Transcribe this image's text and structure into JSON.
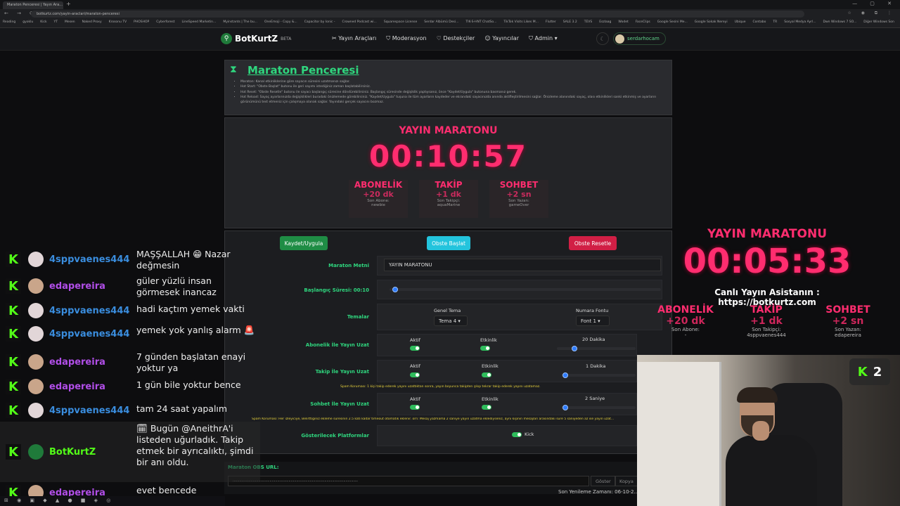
{
  "browser": {
    "tab_title": "Maraton Penceresi | Yayın Ara...",
    "url": "botkurtz.com/yayin-araclari/maraton-penceresi",
    "bookmarks": [
      "Reading",
      "gyoklu",
      "Kick",
      "YT",
      "Mesen",
      "Naked Proxy",
      "Krosonu TV",
      "PHOSHOP",
      "Cyberforest",
      "LineSpeed Marketin...",
      "Myinstants | The bu...",
      "OneEmoji - Copy &...",
      "Capacitor by Ionic -",
      "Crowned Podcast wi...",
      "Squarespace License",
      "Serdar Albümü Desi...",
      "TIK-S-HNT ChatSo...",
      "TikTok Visits Likes M...",
      "Flutter",
      "SALE 3.2",
      "TEVS",
      "Eszlaag",
      "Wodet",
      "FaceClips",
      "Google Sesini Me...",
      "Google Sokak Nereyi",
      "Ubique",
      "Contabo",
      "TR",
      "Sosyal Medya Ayrl...",
      "Dwn Windows 7 SO...",
      "Diğer Windows Son"
    ],
    "profile_label": "Tüm Yer İşaretleri"
  },
  "site_nav": {
    "logo_text": "BotKurtZ",
    "logo_beta": "BETA",
    "menu": [
      "Yayın Araçları",
      "Moderasyon",
      "Destekçiler",
      "Yayıncılar",
      "Admin"
    ],
    "username": "serdarhocam"
  },
  "page": {
    "title": "Maraton Penceresi",
    "info_items": [
      "Maraton: Kanal etkinliklerine göre sayacın süresini uzatmanızı sağlar.",
      "Hot Start: \"Obste Başlat\" butonu ile geri sayımı istediğiniz zaman başlatabilirsiniz.",
      "Hot Reset: \"Obste Resetle\" butonu ile sayacı başlangıç süresine döndürebilirsiniz. Başlangıç süresinde değişiklik yaptıysanız, önce \"Kaydet/Uygula\" butonuna basmanız gerek.",
      "Hot Reload: Sayaç ayarlarınızda değişiklikleri buradaki önizlemede görebilirsiniz. \"Kaydet/Uygula\" tuşuna ile tüm ayarların kaydeder ve ekrandaki sayacınızda anında aktifleştirilmesini sağlar. Önizleme alanındaki sayaç, olası etkinlikleri sanki etkinmiş ve ayarların görünümünü test etmeniz için çalışmaya olanak sağlar. Yayındaki gerçek sayacını bozmaz."
    ]
  },
  "preview": {
    "title": "YAYIN MARATONU",
    "time": "00:10:57",
    "boxes": [
      {
        "head": "ABONELİK",
        "value": "+20 dk",
        "label": "Son Abone:",
        "name": "newbie"
      },
      {
        "head": "TAKİP",
        "value": "+1 dk",
        "label": "Son Takipçi:",
        "name": "aquaMarine"
      },
      {
        "head": "SOHBET",
        "value": "+2 sn",
        "label": "Son Yazan:",
        "name": "gameOver"
      }
    ]
  },
  "actions": {
    "save": "Kaydet/Uygula",
    "start": "Obste Başlat",
    "reset": "Obste Resetle"
  },
  "form": {
    "marathon_text_label": "Maraton Metni",
    "marathon_text_value": "YAYIN MARATONU",
    "start_duration_label": "Başlangıç Süresi: 00:10",
    "start_duration_fraction": 0.01,
    "themes_label": "Temalar",
    "general_theme_label": "Genel Tema",
    "general_theme_value": "Tema 4",
    "number_font_label": "Numara Fontu",
    "number_font_value": "Font 1",
    "sub_label": "Abonelik İle Yayın Uzat",
    "follow_label": "Takip İle Yayın Uzat",
    "chat_label": "Sohbet İle Yayın Uzat",
    "active_label": "Aktif",
    "event_label": "Etkinlik",
    "sub_amount": "20 Dakika",
    "sub_fraction": 0.2,
    "follow_amount": "1 Dakika",
    "follow_fraction": 0.02,
    "chat_amount": "2 Saniye",
    "chat_fraction": 0.02,
    "follow_note": "Spam Koruması: 1 kişi takip ederek yayını uzattıktan sonra, yayın boyunca takipten çıkıp tekrar takip ederek yayını uzatamaz.",
    "chat_note": "Spam Koruması: Her izleyiciye, Belirttiğiniz ekleme süresinin 2.5 katı kadar timeout otomatik eklenir. örn: Mesaj yazmama 2 saniye yayın uzatma eklediyseniz, aynı kişinin mesajları arasındaki süre 5 saniyeden az ise yayın uzat...",
    "platforms_label": "Gösterilecek Platformlar",
    "platform_kick": "Kick",
    "obs_url_label": "Maraton OBS URL:",
    "obs_url_value": "················································································································",
    "show_btn": "Göster",
    "copy_btn": "Kopya",
    "refresh_text": "Son Yenileme Zamanı: 06-10-2..."
  },
  "overlay": {
    "title": "YAYIN MARATONU",
    "time": "00:05:33",
    "cta": "Canlı Yayın Asistanın : https://botkurtz.com",
    "cols": [
      {
        "head": "ABONELİK",
        "value": "+20 dk",
        "label": "Son Abone:",
        "name": "-"
      },
      {
        "head": "TAKİP",
        "value": "+1 dk",
        "label": "Son Takipçi:",
        "name": "4sppvaenes444"
      },
      {
        "head": "SOHBET",
        "value": "+2 sn",
        "label": "Son Yazan:",
        "name": "edapereira"
      }
    ],
    "viewer_count": "2"
  },
  "chat": [
    {
      "user": "4sppvaenes444",
      "color": "#3a8dde",
      "text": "MAŞŞALLAH 😁 Nazar değmesin"
    },
    {
      "user": "edapereira",
      "color": "#b14ee8",
      "text": "güler yüzlü insan görmesek inancaz"
    },
    {
      "user": "4sppvaenes444",
      "color": "#3a8dde",
      "text": "hadi kaçtım yemek vakti"
    },
    {
      "user": "4sppvaenes444",
      "color": "#3a8dde",
      "text": "yemek yok yanlış alarm 🚨"
    },
    {
      "user": "edapereira",
      "color": "#b14ee8",
      "text": "7 günden başlatan enayi yoktur ya"
    },
    {
      "user": "edapereira",
      "color": "#b14ee8",
      "text": "1 gün bile yoktur bence"
    },
    {
      "user": "4sppvaenes444",
      "color": "#3a8dde",
      "text": "tam 24 saat yapalım"
    },
    {
      "user": "BotKurtZ",
      "color": "#53fc18",
      "text": "🗓 Bugün @AneithrA'i listeden uğurladık. Takip etmek bir ayrıcalıktı, şimdi bir anı oldu."
    },
    {
      "user": "edapereira",
      "color": "#b14ee8",
      "text": "evet bencede"
    }
  ]
}
